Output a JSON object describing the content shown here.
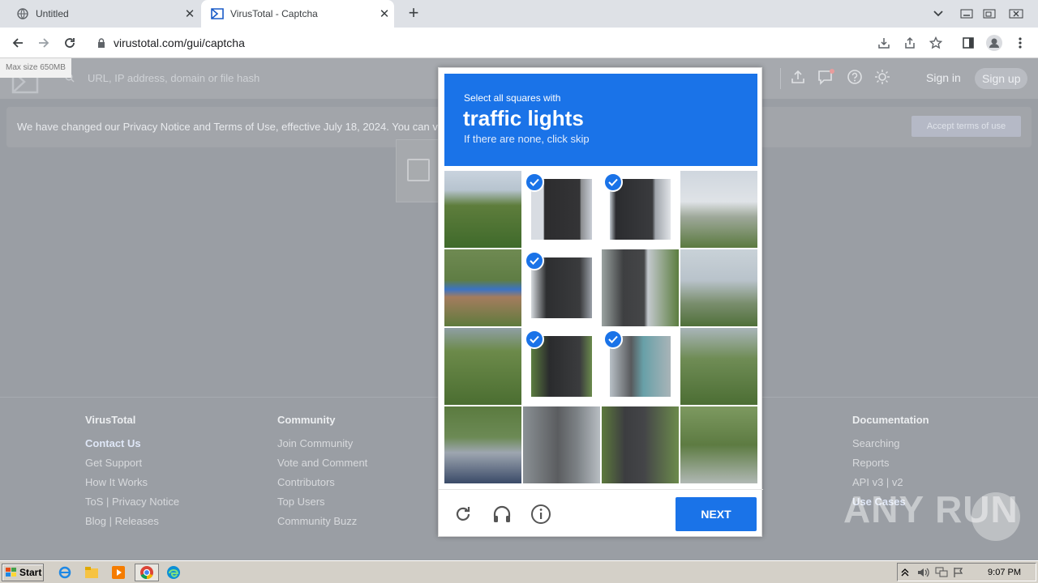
{
  "tabs": [
    {
      "title": "Untitled",
      "close": "✕"
    },
    {
      "title": "VirusTotal - Captcha",
      "close": "✕"
    }
  ],
  "new_tab": "+",
  "address": {
    "url": "virustotal.com/gui/captcha"
  },
  "vt": {
    "max_size": "Max size 650MB",
    "search_placeholder": "URL, IP address, domain or file hash",
    "sign_in": "Sign in",
    "sign_up": "Sign up",
    "notice": "We have changed our Privacy Notice and Terms of Use, effective July 18, 2024. You can v",
    "accept": "Accept terms of use"
  },
  "captcha": {
    "line1": "Select all squares with",
    "line2": "traffic lights",
    "line3": "If there are none, click skip",
    "next": "NEXT",
    "selected": [
      1,
      2,
      5,
      9,
      10
    ]
  },
  "footer": {
    "col1": {
      "title": "VirusTotal",
      "items": [
        "Contact Us",
        "Get Support",
        "How It Works",
        "ToS | Privacy Notice",
        "Blog | Releases"
      ]
    },
    "col2": {
      "title": "Community",
      "items": [
        "Join Community",
        "Vote and Comment",
        "Contributors",
        "Top Users",
        "Community Buzz"
      ]
    },
    "col3": {
      "title": "Documentation",
      "items": [
        "Searching",
        "Reports",
        "API v3 | v2",
        "Use Cases"
      ]
    }
  },
  "watermark": "ANY RUN",
  "taskbar": {
    "start": "Start",
    "clock": "9:07 PM"
  }
}
